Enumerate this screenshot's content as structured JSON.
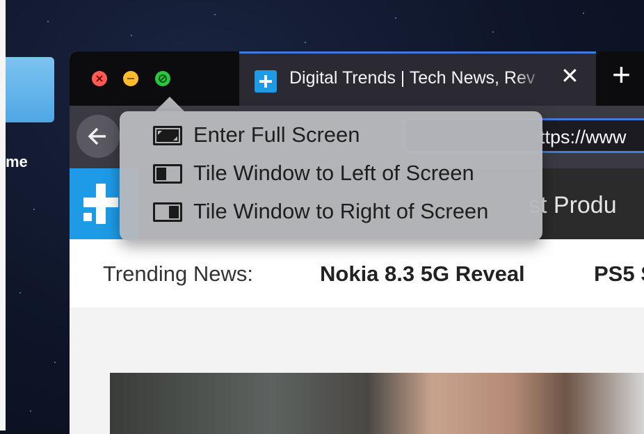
{
  "desktop": {
    "label": "me"
  },
  "browser": {
    "tab": {
      "title": "Digital Trends | Tech News, Rev",
      "close_label": "✕",
      "favicon": "plus-favicon-icon"
    },
    "new_tab_label": "+",
    "toolbar": {
      "url": "ttps://www"
    },
    "site": {
      "nav_partial": "st Produ",
      "trending_label": "Trending News:",
      "trending_items": [
        "Nokia 8.3 5G Reveal",
        "PS5 S"
      ]
    }
  },
  "window_menu": {
    "items": [
      {
        "label": "Enter Full Screen",
        "icon": "full-screen-icon"
      },
      {
        "label": "Tile Window to Left of Screen",
        "icon": "tile-left-icon"
      },
      {
        "label": "Tile Window to Right of Screen",
        "icon": "tile-right-icon"
      }
    ]
  },
  "colors": {
    "accent": "#3d7be0",
    "brand": "#1e9be6",
    "red": "#fe5c55",
    "yellow": "#fdbc2e",
    "green": "#27c840"
  }
}
